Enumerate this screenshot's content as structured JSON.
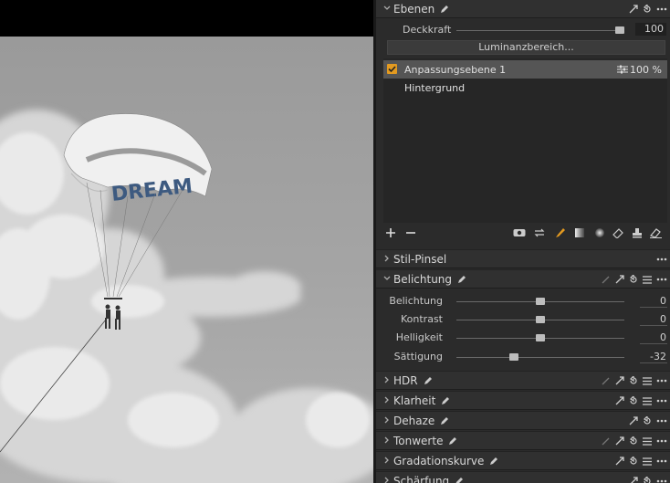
{
  "layers_panel": {
    "title": "Ebenen",
    "opacity_label": "Deckkraft",
    "opacity_value": "100",
    "opacity_fraction": 1.0,
    "luminance_button": "Luminanzbereich...",
    "layers": [
      {
        "name": "Anpassungsebene 1",
        "opacity": "100 %",
        "selected": true,
        "checked": true
      },
      {
        "name": "Hintergrund",
        "opacity": "",
        "selected": false,
        "checked": false
      }
    ],
    "tools": [
      "add-icon",
      "remove-icon",
      "eye-icon",
      "swap-icon",
      "brush-icon",
      "gradient-icon",
      "radial-icon",
      "erase-icon",
      "stamp-icon",
      "eraser-icon"
    ]
  },
  "sections": {
    "stil_pinsel": "Stil-Pinsel",
    "belichtung": "Belichtung",
    "hdr": "HDR",
    "klarheit": "Klarheit",
    "dehaze": "Dehaze",
    "tonwerte": "Tonwerte",
    "gradationskurve": "Gradationskurve",
    "schaerfung": "Schärfung"
  },
  "exposure": {
    "rows": [
      {
        "label": "Belichtung",
        "value": "0",
        "fraction": 0.5
      },
      {
        "label": "Kontrast",
        "value": "0",
        "fraction": 0.5
      },
      {
        "label": "Helligkeit",
        "value": "0",
        "fraction": 0.5
      },
      {
        "label": "Sättigung",
        "value": "-32",
        "fraction": 0.34
      }
    ]
  },
  "photo": {
    "canopy_text": "DREAM"
  },
  "colors": {
    "accent": "#e39a20",
    "panel_bg": "#2b2b2b",
    "header_bg": "#303030"
  }
}
